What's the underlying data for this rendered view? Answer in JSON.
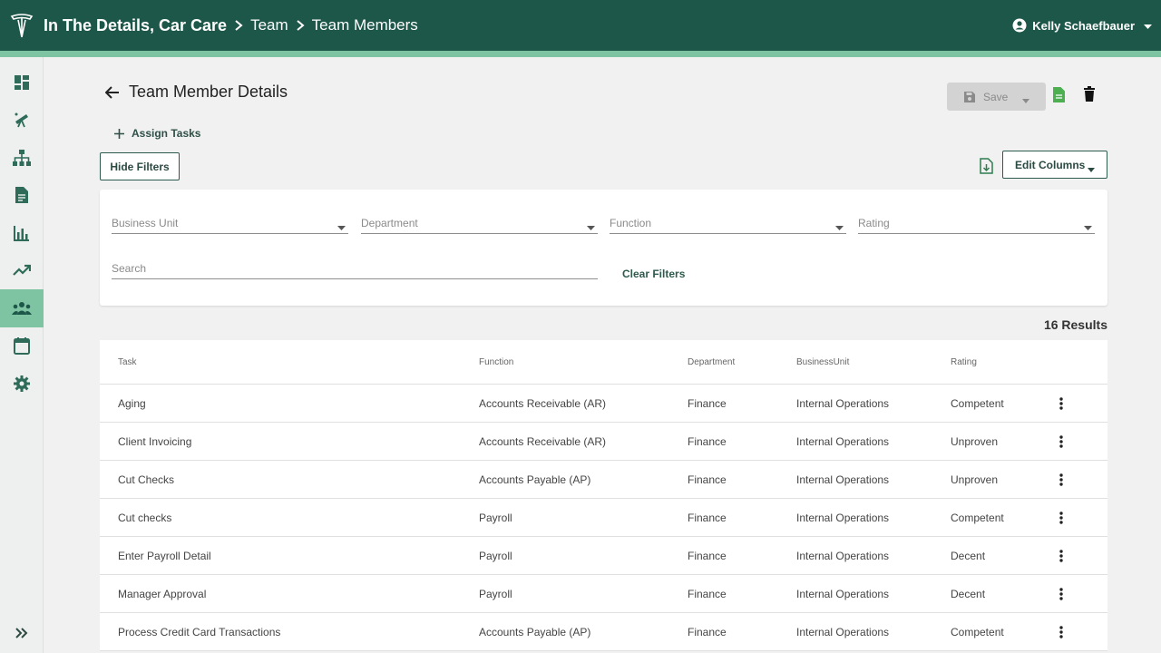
{
  "header": {
    "company": "In The Details, Car Care",
    "crumb_team": "Team",
    "crumb_members": "Team Members",
    "user_name": "Kelly Schaefbauer"
  },
  "sidebar": {
    "items": [
      {
        "icon": "dashboard-icon"
      },
      {
        "icon": "telescope-icon"
      },
      {
        "icon": "org-chart-icon"
      },
      {
        "icon": "document-icon"
      },
      {
        "icon": "bar-chart-icon"
      },
      {
        "icon": "trend-icon"
      },
      {
        "icon": "team-icon",
        "active": true
      },
      {
        "icon": "calendar-icon"
      },
      {
        "icon": "gear-icon"
      }
    ]
  },
  "page": {
    "title": "Team Member Details",
    "save_label": "Save",
    "assign_label": "Assign Tasks",
    "hide_filters_label": "Hide Filters",
    "edit_columns_label": "Edit Columns",
    "results_label": "16 Results"
  },
  "filters": {
    "business_unit": "Business Unit",
    "department": "Department",
    "function": "Function",
    "rating": "Rating",
    "search_placeholder": "Search",
    "clear_label": "Clear Filters"
  },
  "table": {
    "headers": [
      "Task",
      "Function",
      "Department",
      "BusinessUnit",
      "Rating"
    ],
    "rows": [
      {
        "task": "Aging",
        "function": "Accounts Receivable (AR)",
        "department": "Finance",
        "business_unit": "Internal Operations",
        "rating": "Competent"
      },
      {
        "task": "Client Invoicing",
        "function": "Accounts Receivable (AR)",
        "department": "Finance",
        "business_unit": "Internal Operations",
        "rating": "Unproven"
      },
      {
        "task": "Cut Checks",
        "function": "Accounts Payable (AP)",
        "department": "Finance",
        "business_unit": "Internal Operations",
        "rating": "Unproven"
      },
      {
        "task": "Cut checks",
        "function": "Payroll",
        "department": "Finance",
        "business_unit": "Internal Operations",
        "rating": "Competent"
      },
      {
        "task": "Enter Payroll Detail",
        "function": "Payroll",
        "department": "Finance",
        "business_unit": "Internal Operations",
        "rating": "Decent"
      },
      {
        "task": "Manager Approval",
        "function": "Payroll",
        "department": "Finance",
        "business_unit": "Internal Operations",
        "rating": "Decent"
      },
      {
        "task": "Process Credit Card Transactions",
        "function": "Accounts Payable (AP)",
        "department": "Finance",
        "business_unit": "Internal Operations",
        "rating": "Competent"
      }
    ]
  },
  "colors": {
    "header_bg": "#1d5749",
    "accent": "#7ec4a2",
    "icon_green": "#2e6b59",
    "doc_green": "#4caf50"
  }
}
